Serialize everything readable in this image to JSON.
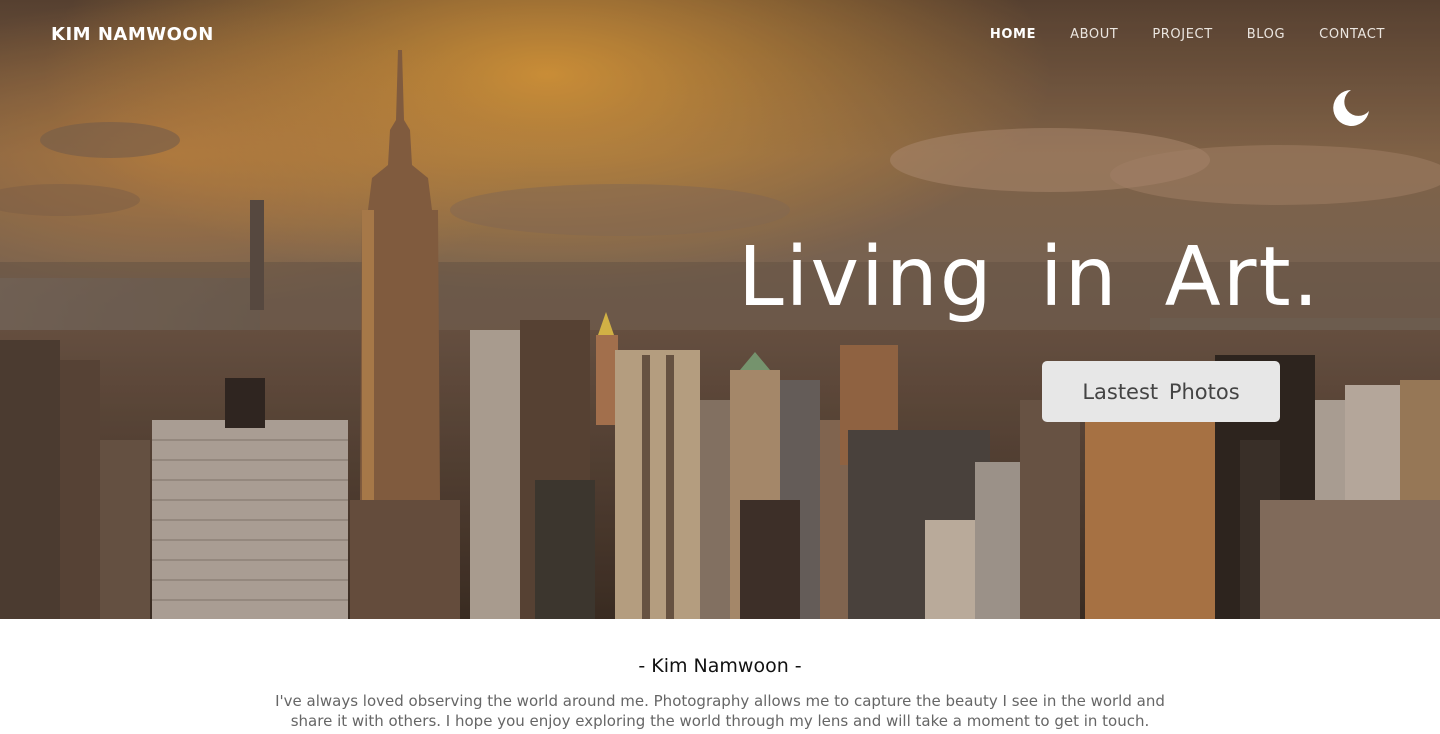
{
  "header": {
    "brand": "KIM NAMWOON",
    "nav": [
      {
        "label": "HOME",
        "active": true
      },
      {
        "label": "ABOUT",
        "active": false
      },
      {
        "label": "PROJECT",
        "active": false
      },
      {
        "label": "BLOG",
        "active": false
      },
      {
        "label": "CONTACT",
        "active": false
      }
    ],
    "theme_icon": "moon-icon"
  },
  "hero": {
    "headline": "Living in Art.",
    "cta_label": "Lastest Photos",
    "image": "city-skyline-sunset-photo"
  },
  "intro": {
    "name": "- Kim Namwoon -",
    "text": "I've always loved observing the world around me. Photography allows me to capture the beauty I see in the world and share it with others. I hope you enjoy exploring the world through my lens and will take a moment to get in touch."
  },
  "colors": {
    "cta_bg": "#e7e7e7",
    "cta_text": "#444444",
    "nav_text": "#ffffff",
    "sky_gold": "#e0a04a"
  }
}
